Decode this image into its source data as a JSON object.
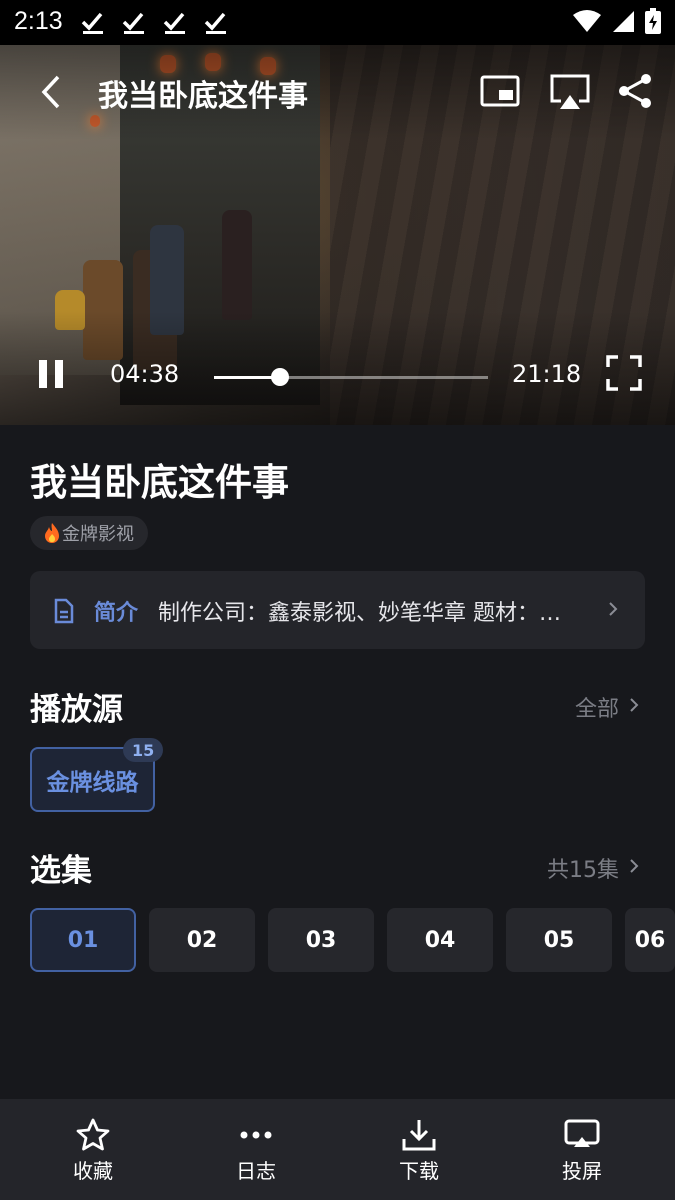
{
  "status_bar": {
    "time": "2:13"
  },
  "player": {
    "title": "我当卧底这件事",
    "current_time": "04:38",
    "total_time": "21:18",
    "progress": 0.24
  },
  "show": {
    "title": "我当卧底这件事",
    "tag": "金牌影视"
  },
  "intro": {
    "label": "简介",
    "text": "制作公司：鑫泰影视、妙笔华章 题材：…"
  },
  "sources": {
    "title": "播放源",
    "link": "全部",
    "items": [
      {
        "label": "金牌线路",
        "badge": "15"
      }
    ]
  },
  "episodes": {
    "title": "选集",
    "link": "共15集",
    "items": [
      "01",
      "02",
      "03",
      "04",
      "05",
      "06"
    ],
    "active_index": 0
  },
  "bottom_nav": {
    "items": [
      {
        "label": "收藏",
        "icon": "star-icon"
      },
      {
        "label": "日志",
        "icon": "more-dots-icon"
      },
      {
        "label": "下载",
        "icon": "download-icon"
      },
      {
        "label": "投屏",
        "icon": "cast-icon"
      }
    ]
  },
  "colors": {
    "accent": "#4261a2",
    "accent_text": "#6a90e0",
    "background": "#17181c",
    "surface": "#24252a"
  }
}
